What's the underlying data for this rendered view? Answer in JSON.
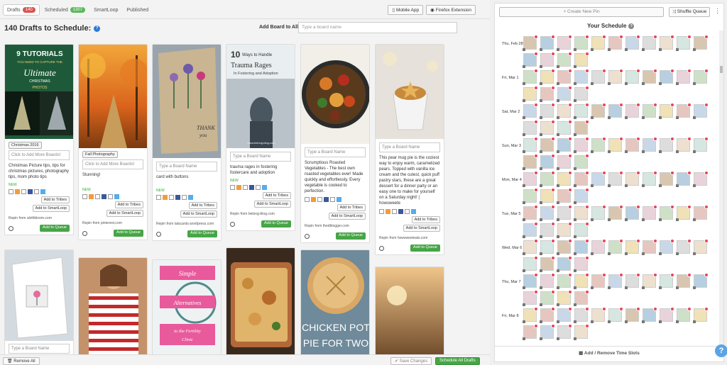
{
  "nav": {
    "tabs": [
      {
        "label": "Drafts",
        "badge": "140",
        "badge_color": "#d9534f"
      },
      {
        "label": "Scheduled",
        "badge": "1307",
        "badge_color": "#5cb85c"
      },
      {
        "label": "SmartLoop"
      },
      {
        "label": "Published"
      }
    ],
    "mobile_app": "Mobile App",
    "firefox_ext": "Firefox Extension"
  },
  "page": {
    "title": "140 Drafts to Schedule:",
    "add_board_label": "Add Board to All:",
    "add_board_placeholder": "Type a board name"
  },
  "cards": [
    {
      "tag": "Christmas 2016",
      "boards": "Click to Add More Boards!",
      "desc": "Christmas Picture tips, tips for christmas pictures, photography tips, mom photo tips",
      "repin": "Repin from alxthbloom.com",
      "img_top_text": "9 TUTORIALS",
      "img_sub": "YOU NEED TO CAPTURE THE Ultimate CHRISTMAS PHOTOS"
    },
    {
      "tag": "Fall Photography",
      "boards": "Click to Add More Boards!",
      "desc": "Stunning!",
      "repin": "Repin from pinterest.com"
    },
    {
      "tag": "",
      "boards": "Type a Board Name",
      "desc": "card with buttons",
      "repin": "Repin from latscards.wordpress.com",
      "img_text": "THANK you"
    },
    {
      "tag": "",
      "boards": "Type a Board Name",
      "desc": "trauma rages in fostering fostercare and adoption",
      "repin": "Repin from belong-blog.com",
      "img_title": "10 Ways to Handle Trauma Rages",
      "img_sub": "In Fostering and Adoption",
      "img_url": "www.belong-blog.com"
    },
    {
      "tag": "",
      "boards": "Type a Board Name",
      "desc": "Scrumptious Roasted Vegetables - The best own roasted vegetables ever! Made quickly and effortlessly. Every vegetable is cooked to perfection.",
      "repin": "Repin from thedblogger.com"
    },
    {
      "tag": "",
      "boards": "Type a Board Name",
      "desc": "This pear mug pie is the coziest way to enjoy warm, caramelized pears. Topped with vanilla ice cream and the cutest, quick puff pastry stars, these are a great dessert for a dinner party or an easy one to make for yourself on a Saturday night! | howsweete",
      "repin": "Repin from howsweeteats.com"
    }
  ],
  "card_common": {
    "new": "NEW",
    "add_tribes": "Add to Tribes",
    "add_smartloop": "Add to SmartLoop",
    "add_queue": "Add to Queue"
  },
  "bottom_cards": {
    "type_board": "Type a Board Name",
    "simple_1": "Simple",
    "simple_2": "Alternatives",
    "simple_3": "to the Fertility Clinic",
    "chicken": "CHICKEN POT PIE FOR TWO"
  },
  "footer": {
    "remove_all": "Remove All",
    "save_changes": "Save Changes",
    "schedule_all": "Schedule All Drafts"
  },
  "schedule": {
    "create_pin": "+ Create New Pin",
    "shuffle": "Shuffle Queue",
    "title": "Your Schedule",
    "add_slots": "Add / Remove Time Slots",
    "days": [
      "Thu, Feb 28",
      "Fri, Mar 1",
      "Sat, Mar 2",
      "Sun, Mar 3",
      "Mon, Mar 4",
      "Tue, Mar 5",
      "Wed, Mar 6",
      "Thu, Mar 7",
      "Fri, Mar 8"
    ]
  },
  "colors": {
    "accent_green": "#46a546",
    "pin_red": "#e8445a",
    "help_blue": "#5aa4e6"
  }
}
